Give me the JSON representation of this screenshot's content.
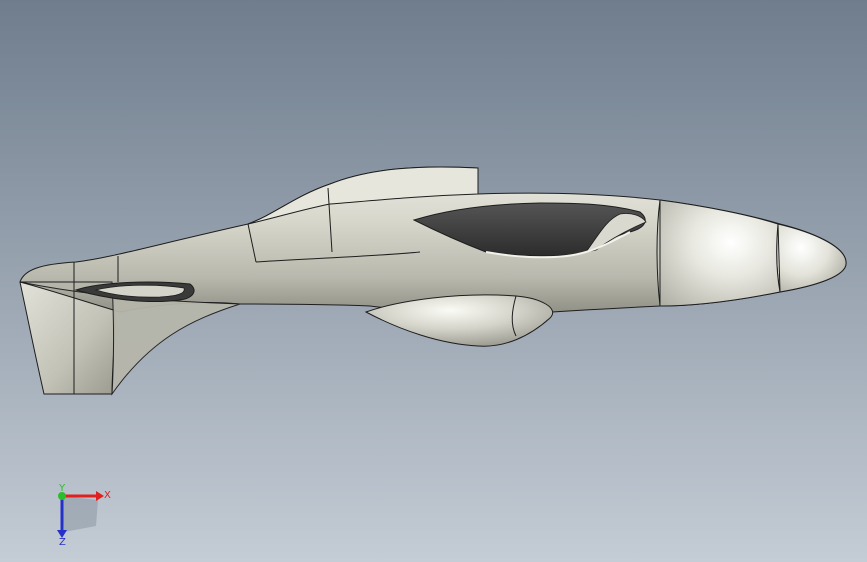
{
  "viewport": {
    "background_top": "#6f7d8d",
    "background_bottom": "#c4ccd5"
  },
  "model": {
    "name": "aircraft-fuselage",
    "body_color": "#cfcfc4",
    "body_highlight": "#f7f7f2",
    "body_shadow": "#8e8e84",
    "edge_color": "#1e1e1e",
    "canopy_dark": "#3a3a3a"
  },
  "triad": {
    "x_label": "X",
    "y_label": "Y",
    "z_label": "Z",
    "x_color": "#e0201f",
    "y_color": "#2bbd2b",
    "z_color": "#2530c8"
  }
}
